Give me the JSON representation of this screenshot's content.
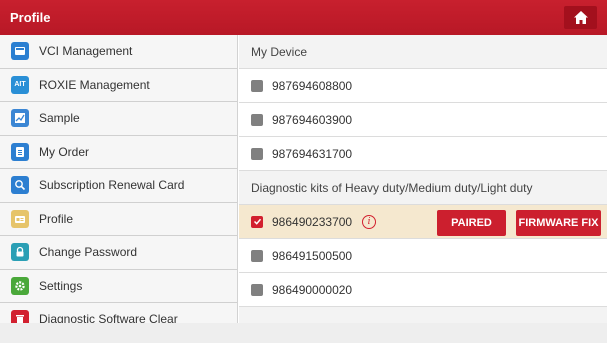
{
  "header": {
    "title": "Profile",
    "home_icon": "home-icon",
    "accent": "#c8202e"
  },
  "sidebar": {
    "items": [
      {
        "label": "VCI Management",
        "icon": "vci-icon",
        "color": "#2b7fd1"
      },
      {
        "label": "ROXIE Management",
        "icon": "ait-icon",
        "icon_text": "AIT",
        "color": "#2a8fd6"
      },
      {
        "label": "Sample",
        "icon": "chart-icon",
        "color": "#3b86d4"
      },
      {
        "label": "My Order",
        "icon": "clipboard-icon",
        "color": "#2d7fd1"
      },
      {
        "label": "Subscription Renewal Card",
        "icon": "search-icon",
        "color": "#2d7fd1"
      },
      {
        "label": "Profile",
        "icon": "id-card-icon",
        "color": "#e6c46a"
      },
      {
        "label": "Change Password",
        "icon": "lock-icon",
        "color": "#2a9fb5"
      },
      {
        "label": "Settings",
        "icon": "gear-icon",
        "color": "#4aa83a"
      },
      {
        "label": "Diagnostic Software Clear",
        "icon": "trash-icon",
        "color": "#d2202f"
      }
    ]
  },
  "main": {
    "section1_title": "My Device",
    "devices1": [
      {
        "serial": "987694608800",
        "checked": false
      },
      {
        "serial": "987694603900",
        "checked": false
      },
      {
        "serial": "987694631700",
        "checked": false
      }
    ],
    "section2_title": "Diagnostic kits of Heavy duty/Medium duty/Light duty",
    "selected_device": {
      "serial": "986490233700",
      "checked": true,
      "info_icon": "info-icon",
      "paired_label": "PAIRED",
      "firmware_label": "FIRMWARE FIX"
    },
    "devices2": [
      {
        "serial": "986491500500",
        "checked": false
      },
      {
        "serial": "986490000020",
        "checked": false
      }
    ]
  }
}
